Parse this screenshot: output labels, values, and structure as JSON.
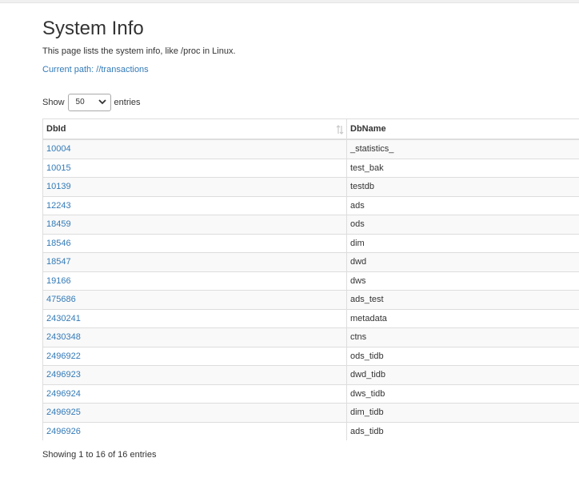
{
  "page": {
    "title": "System Info",
    "description": "This page lists the system info, like /proc in Linux.",
    "current_path": "Current path: //transactions"
  },
  "length_control": {
    "prefix": "Show",
    "selected": "50",
    "suffix": "entries"
  },
  "table": {
    "columns": [
      "DbId",
      "DbName"
    ],
    "rows": [
      {
        "dbid": "10004",
        "dbname": "_statistics_"
      },
      {
        "dbid": "10015",
        "dbname": "test_bak"
      },
      {
        "dbid": "10139",
        "dbname": "testdb"
      },
      {
        "dbid": "12243",
        "dbname": "ads"
      },
      {
        "dbid": "18459",
        "dbname": "ods"
      },
      {
        "dbid": "18546",
        "dbname": "dim"
      },
      {
        "dbid": "18547",
        "dbname": "dwd"
      },
      {
        "dbid": "19166",
        "dbname": "dws"
      },
      {
        "dbid": "475686",
        "dbname": "ads_test"
      },
      {
        "dbid": "2430241",
        "dbname": "metadata"
      },
      {
        "dbid": "2430348",
        "dbname": "ctns"
      },
      {
        "dbid": "2496922",
        "dbname": "ods_tidb"
      },
      {
        "dbid": "2496923",
        "dbname": "dwd_tidb"
      },
      {
        "dbid": "2496924",
        "dbname": "dws_tidb"
      },
      {
        "dbid": "2496925",
        "dbname": "dim_tidb"
      },
      {
        "dbid": "2496926",
        "dbname": "ads_tidb"
      }
    ]
  },
  "info": "Showing 1 to 16 of 16 entries",
  "icons": {
    "sort": "sort-both-icon",
    "select": "chevron-down-icon"
  },
  "colors": {
    "link": "#337ab7",
    "stripe": "#f9f9f9",
    "border": "#dddddd"
  }
}
